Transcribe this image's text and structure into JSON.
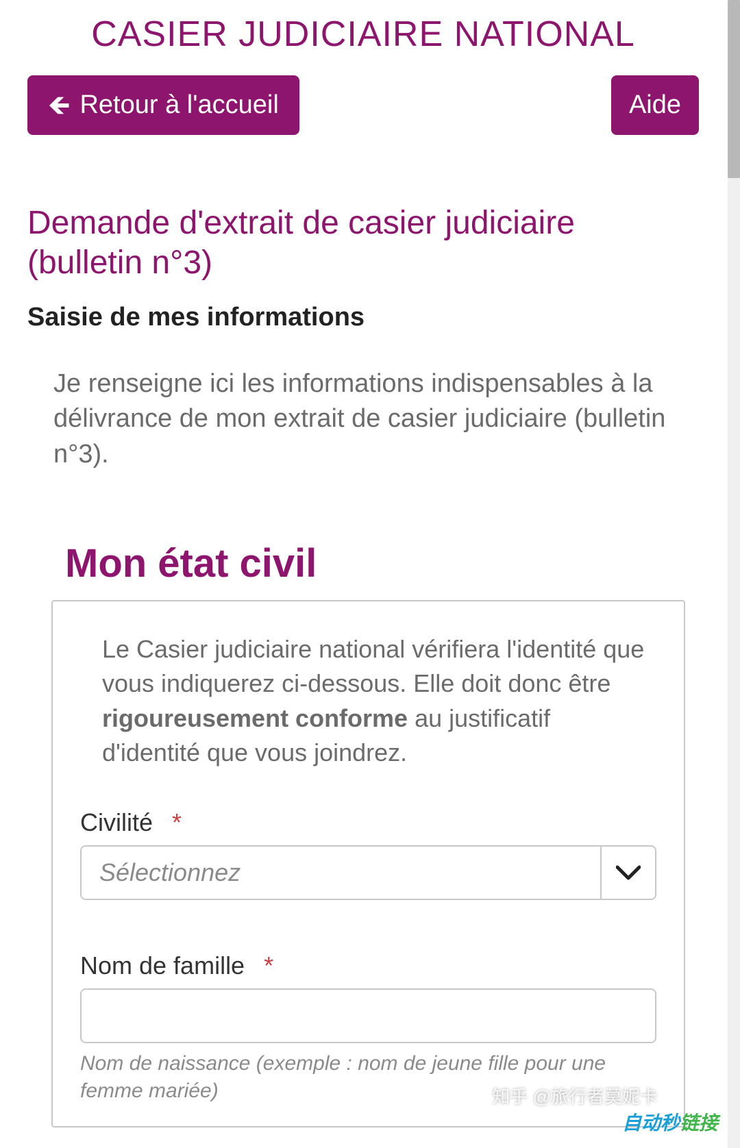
{
  "colors": {
    "brand": "#8e156e",
    "text_muted": "#6b6b6b",
    "border": "#c8c8c8"
  },
  "header": {
    "site_title": "CASIER JUDICIAIRE NATIONAL"
  },
  "buttons": {
    "home_label": "Retour à l'accueil",
    "help_label": "Aide"
  },
  "page": {
    "title": "Demande d'extrait de casier judiciaire (bulletin n°3)",
    "subheading": "Saisie de mes informations",
    "intro": "Je renseigne ici les informations indispensables à la délivrance de mon extrait de casier judiciaire (bulletin n°3)."
  },
  "form": {
    "section_title": "Mon état civil",
    "notice_pre": "Le Casier judiciaire national vérifiera l'identité que vous indiquerez ci-dessous. Elle doit donc être ",
    "notice_bold": "rigoureusement conforme",
    "notice_post": " au justificatif d'identité que vous joindrez.",
    "civilite": {
      "label": "Civilité",
      "required_mark": "*",
      "placeholder": "Sélectionnez"
    },
    "nom": {
      "label": "Nom de famille",
      "required_mark": "*",
      "value": "",
      "helper": "Nom de naissance (exemple : nom de jeune fille pour une femme mariée)"
    }
  },
  "watermarks": {
    "zhihu": "知乎 @旅行者莫妮卡",
    "badge_part1": "自动秒",
    "badge_part2": "链接"
  }
}
